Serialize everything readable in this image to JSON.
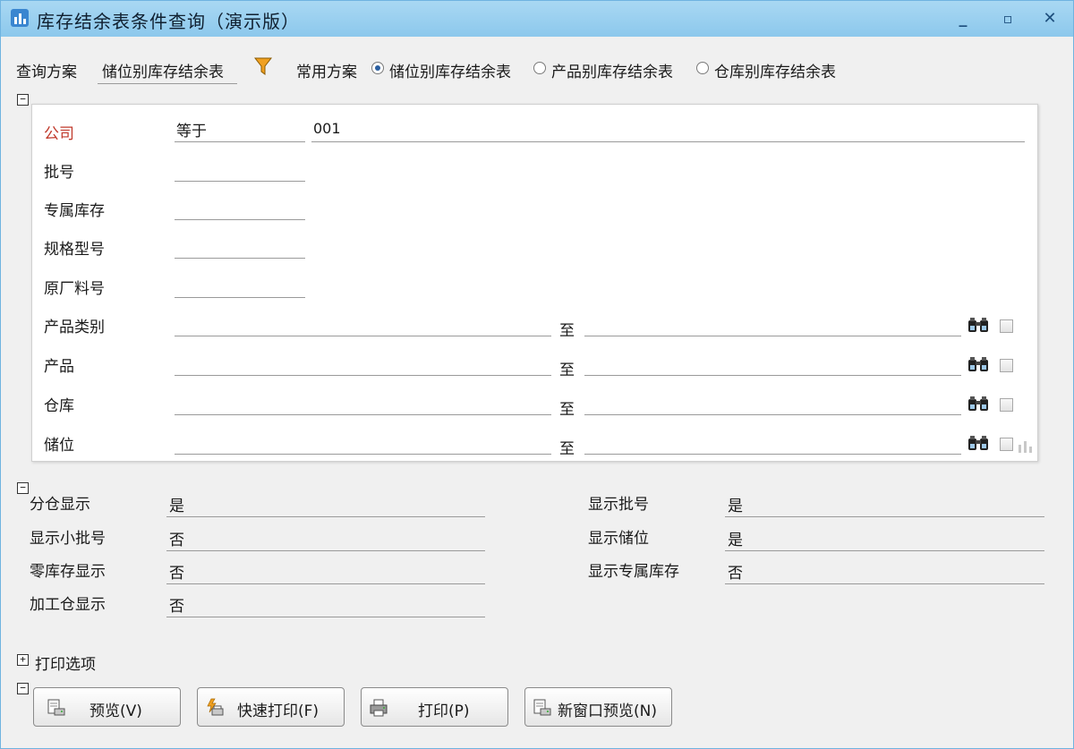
{
  "window": {
    "title": "库存结余表条件查询（演示版）",
    "minimize": "_",
    "maximize": "▫",
    "close": "✕"
  },
  "scheme": {
    "label": "查询方案",
    "value": "储位别库存结余表",
    "common_label": "常用方案",
    "options": [
      {
        "label": "储位别库存结余表",
        "selected": true
      },
      {
        "label": "产品别库存结余表",
        "selected": false
      },
      {
        "label": "仓库别库存结余表",
        "selected": false
      }
    ]
  },
  "conditions": {
    "company": {
      "label": "公司",
      "operator": "等于",
      "value": "001"
    },
    "batch_no": {
      "label": "批号",
      "value": ""
    },
    "exclusive_stock": {
      "label": "专属库存",
      "value": ""
    },
    "spec_model": {
      "label": "规格型号",
      "value": ""
    },
    "factory_part_no": {
      "label": "原厂料号",
      "value": ""
    },
    "range_sep": "至",
    "ranges": [
      {
        "label": "产品类别",
        "from": "",
        "to": ""
      },
      {
        "label": "产品",
        "from": "",
        "to": ""
      },
      {
        "label": "仓库",
        "from": "",
        "to": ""
      },
      {
        "label": "储位",
        "from": "",
        "to": ""
      }
    ]
  },
  "display": {
    "left": [
      {
        "label": "分仓显示",
        "value": "是"
      },
      {
        "label": "显示小批号",
        "value": "否"
      },
      {
        "label": "零库存显示",
        "value": "否"
      },
      {
        "label": "加工仓显示",
        "value": "否"
      }
    ],
    "right": [
      {
        "label": "显示批号",
        "value": "是"
      },
      {
        "label": "显示储位",
        "value": "是"
      },
      {
        "label": "显示专属库存",
        "value": "否"
      }
    ]
  },
  "print_options": {
    "label": "打印选项",
    "expander": "+"
  },
  "expanders": {
    "collapse": "−"
  },
  "buttons": {
    "preview": "预览(V)",
    "quick_print": "快速打印(F)",
    "print": "打印(P)",
    "new_window_preview": "新窗口预览(N)"
  },
  "colors": {
    "titlebar": "#8cc8ec",
    "required_label": "#c0392b",
    "window_bg": "#f0f0f0"
  }
}
